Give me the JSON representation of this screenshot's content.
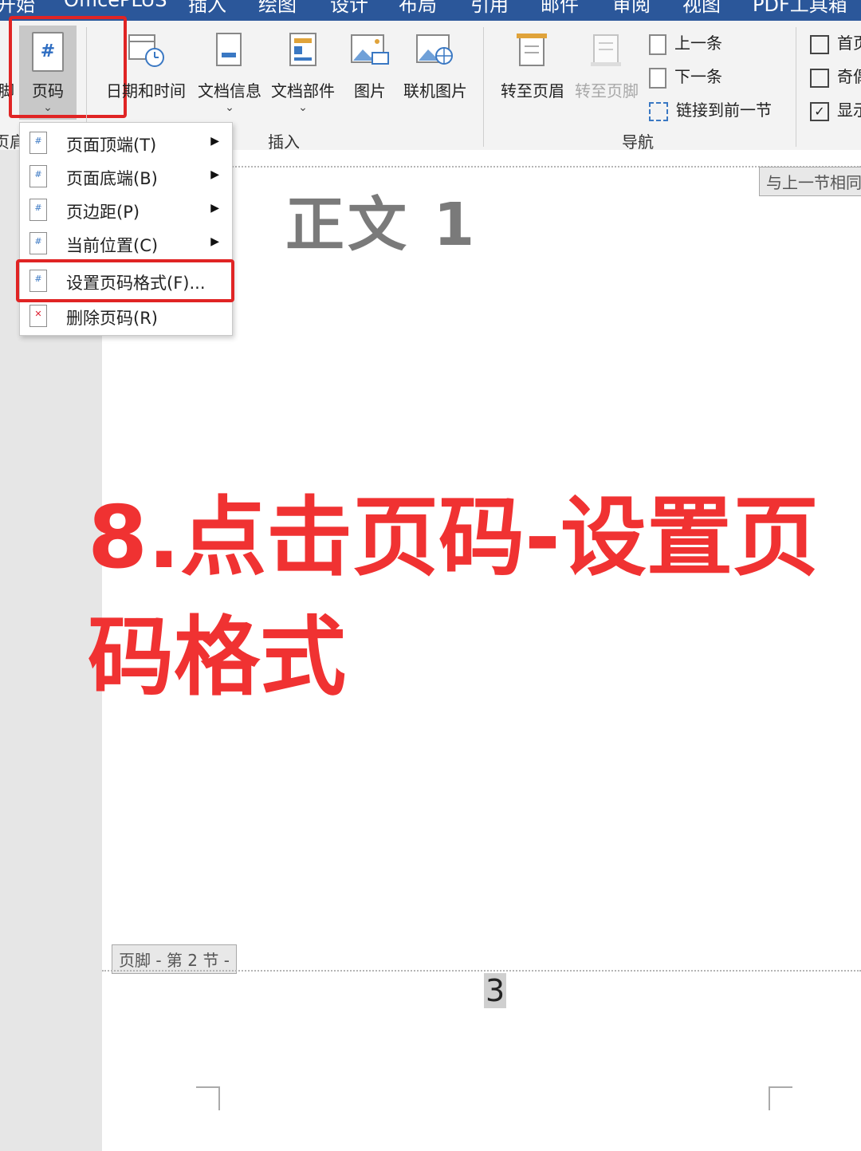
{
  "tabs": [
    "开始",
    "OfficePLUS",
    "插入",
    "绘图",
    "设计",
    "布局",
    "引用",
    "邮件",
    "审阅",
    "视图",
    "PDF工具箱"
  ],
  "ribbon": {
    "left_cut_label": "脚",
    "page_number_button": {
      "label": "页码",
      "icon_glyph": "#"
    },
    "date_time": "日期和时间",
    "doc_info": "文档信息",
    "doc_parts": "文档部件",
    "picture": "图片",
    "online_picture": "联机图片",
    "goto_header": "转至页眉",
    "goto_footer": "转至页脚",
    "prev": "上一条",
    "next": "下一条",
    "link_prev": "链接到前一节",
    "group_insert": "插入",
    "group_nav": "导航",
    "group_left_cut": "页肩",
    "opt_first": "首页",
    "opt_odd": "奇偶",
    "opt_show": "显示"
  },
  "menu": {
    "items": [
      {
        "label": "页面顶端(T)",
        "has_submenu": true
      },
      {
        "label": "页面底端(B)",
        "has_submenu": true
      },
      {
        "label": "页边距(P)",
        "has_submenu": true
      },
      {
        "label": "当前位置(C)",
        "has_submenu": true
      },
      {
        "label": "设置页码格式(F)...",
        "has_submenu": false
      },
      {
        "label": "删除页码(R)",
        "has_submenu": false
      }
    ]
  },
  "document": {
    "same_as_previous": "与上一节相同",
    "heading": "正文 1",
    "footer_tag": "页脚 - 第 2 节 -",
    "page_number": "3"
  },
  "overlay": {
    "line1": "8.点击页码-设置页",
    "line2": "码格式"
  },
  "colors": {
    "title_bar": "#2b579a",
    "highlight": "#e02424",
    "overlay_text": "#f03232"
  }
}
